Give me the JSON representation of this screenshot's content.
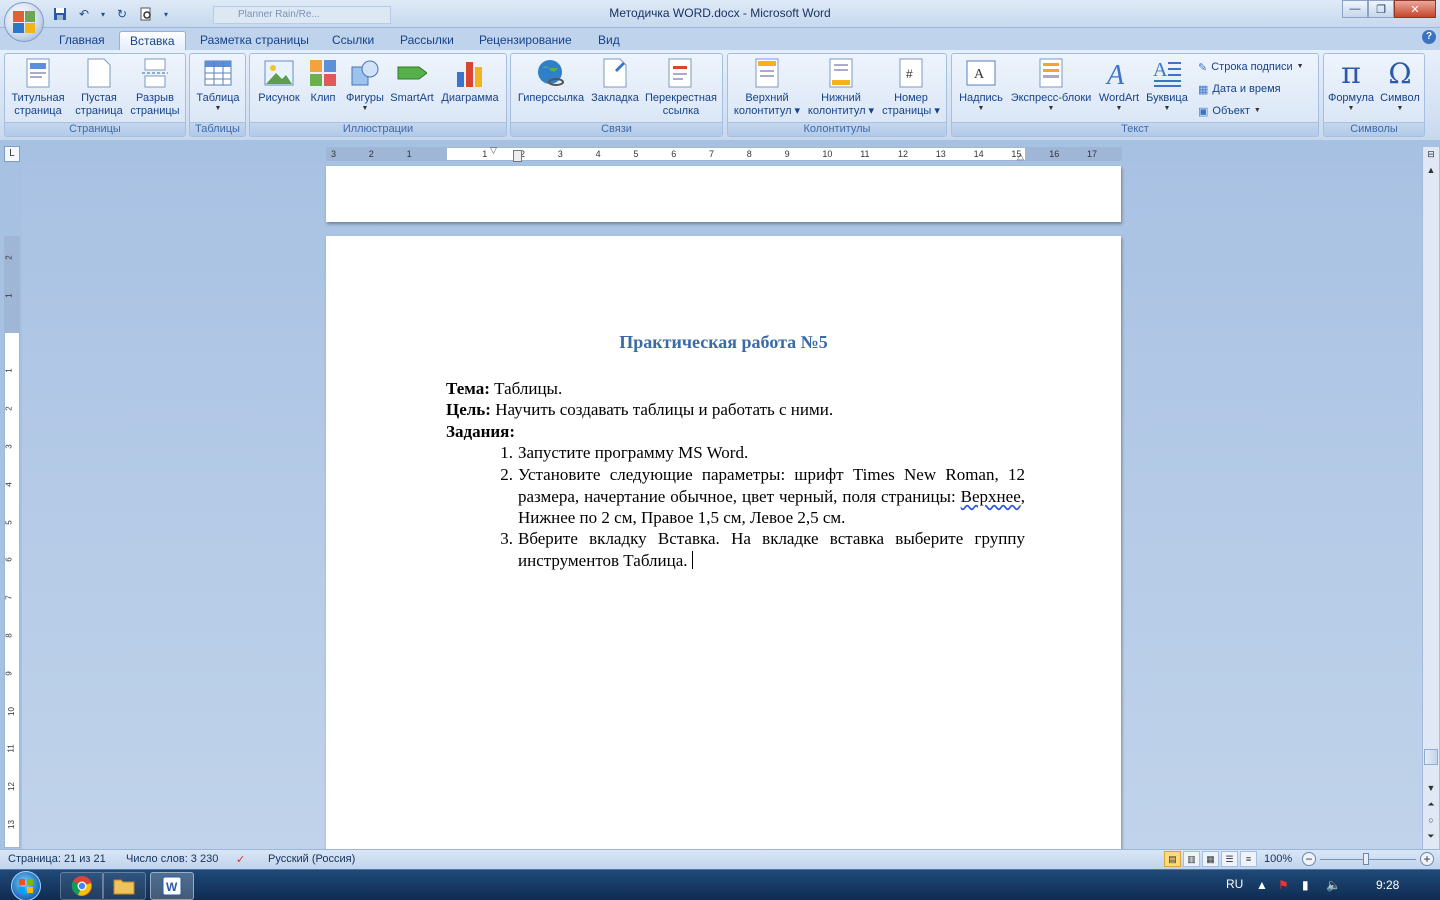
{
  "window": {
    "title": "Методичка WORD.docx - Microsoft Word",
    "tab_hint": "Planner Rain/Re..."
  },
  "qat": {
    "icons": [
      "save-icon",
      "undo-icon",
      "redo-icon",
      "print-preview-icon",
      "customize-qat-icon"
    ]
  },
  "tabs": [
    {
      "label": "Главная"
    },
    {
      "label": "Вставка",
      "active": true
    },
    {
      "label": "Разметка страницы"
    },
    {
      "label": "Ссылки"
    },
    {
      "label": "Рассылки"
    },
    {
      "label": "Рецензирование"
    },
    {
      "label": "Вид"
    }
  ],
  "ribbon": {
    "pages": {
      "label": "Страницы",
      "title_page": "Титульная",
      "title_page2": "страница",
      "blank": "Пустая",
      "blank2": "страница",
      "break": "Разрыв",
      "break2": "страницы"
    },
    "tables": {
      "label": "Таблицы",
      "table": "Таблица"
    },
    "illustrations": {
      "label": "Иллюстрации",
      "picture": "Рисунок",
      "clip": "Клип",
      "shapes": "Фигуры",
      "smartart": "SmartArt",
      "chart": "Диаграмма"
    },
    "links": {
      "label": "Связи",
      "hyperlink": "Гиперссылка",
      "bookmark": "Закладка",
      "crossref": "Перекрестная",
      "crossref2": "ссылка"
    },
    "headerfooter": {
      "label": "Колонтитулы",
      "header": "Верхний",
      "header2": "колонтитул",
      "footer": "Нижний",
      "footer2": "колонтитул",
      "pagenum": "Номер",
      "pagenum2": "страницы"
    },
    "text": {
      "label": "Текст",
      "textbox": "Надпись",
      "quickparts": "Экспресс-блоки",
      "wordart": "WordArt",
      "dropcap": "Буквица",
      "signature": "Строка подписи",
      "datetime": "Дата и время",
      "object": "Объект"
    },
    "symbols": {
      "label": "Символы",
      "formula": "Формула",
      "symbol": "Символ"
    }
  },
  "ruler": {
    "numbers": [
      "3",
      "2",
      "1",
      "",
      "1",
      "2",
      "3",
      "4",
      "5",
      "6",
      "7",
      "8",
      "9",
      "10",
      "11",
      "12",
      "13",
      "14",
      "15",
      "16",
      "17"
    ],
    "vnumbers": [
      "2",
      "1",
      "",
      "1",
      "2",
      "3",
      "4",
      "5",
      "6",
      "7",
      "8",
      "9",
      "10",
      "11",
      "12",
      "13"
    ]
  },
  "document": {
    "title": "Практическая работа №5",
    "topic_label": "Тема:",
    "topic": " Таблицы.",
    "goal_label": "Цель:",
    "goal": " Научить создавать таблицы и работать с ними.",
    "tasks_label": "Задания:",
    "items": [
      {
        "num": "1.",
        "text": "Запустите программу MS Word."
      },
      {
        "num": "2.",
        "text_a": "Установите следующие параметры: шрифт Times New Roman, 12 размера, начертание обычное, цвет черный, поля страницы: ",
        "text_squig": "Верхнее",
        "text_b": ", Нижнее по 2 см, Правое 1,5 см, Левое 2,5 см."
      },
      {
        "num": "3.",
        "text": "Вберите вкладку Вставка. На вкладке вставка выберите группу инструментов Таблица."
      }
    ]
  },
  "status": {
    "page": "Страница: 21 из 21",
    "words": "Число слов: 3 230",
    "language": "Русский (Россия)",
    "zoom": "100%"
  },
  "taskbar": {
    "lang": "RU",
    "time": "9:28",
    "apps": [
      "chrome-icon",
      "explorer-icon",
      "word-icon"
    ]
  }
}
